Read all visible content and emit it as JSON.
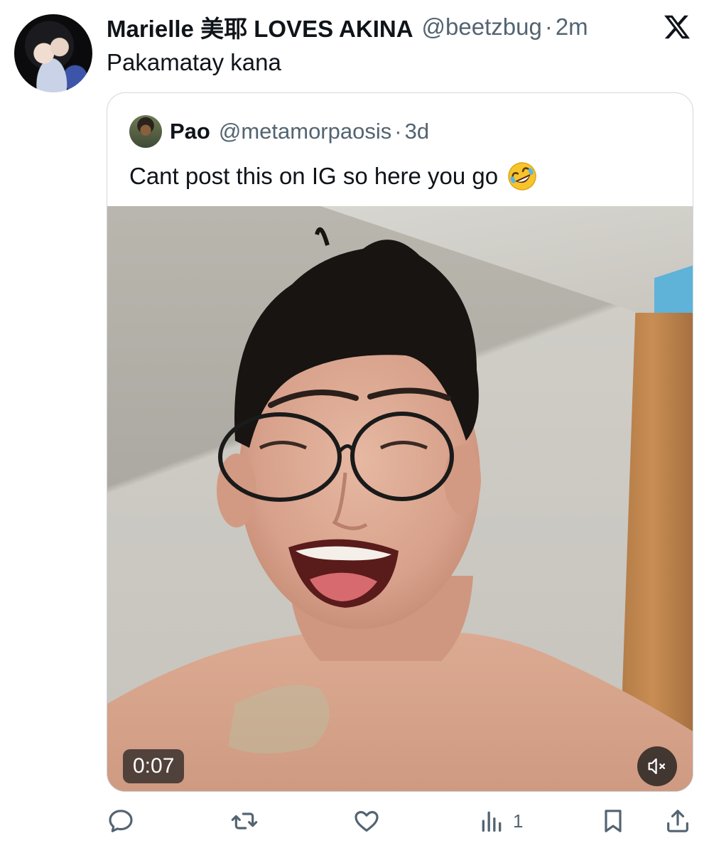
{
  "tweet": {
    "display_name": "Marielle 美耶 LOVES AKINA",
    "handle": "@beetzbug",
    "separator": "·",
    "time": "2m",
    "text": "Pakamatay kana"
  },
  "quoted_tweet": {
    "display_name": "Pao",
    "handle": "@metamorpaosis",
    "separator": "·",
    "time": "3d",
    "text": "Cant post this on IG so here you go",
    "emoji": "rolling-on-floor-laughing-icon",
    "video": {
      "duration": "0:07",
      "muted": true
    }
  },
  "actions": {
    "reply": "reply-icon",
    "retweet": "retweet-icon",
    "like": "like-icon",
    "views": "views-icon",
    "views_count": "1",
    "bookmark": "bookmark-icon",
    "share": "share-icon"
  },
  "colors": {
    "text": "#0f1419",
    "secondary": "#536471",
    "border": "#cfd9de"
  }
}
